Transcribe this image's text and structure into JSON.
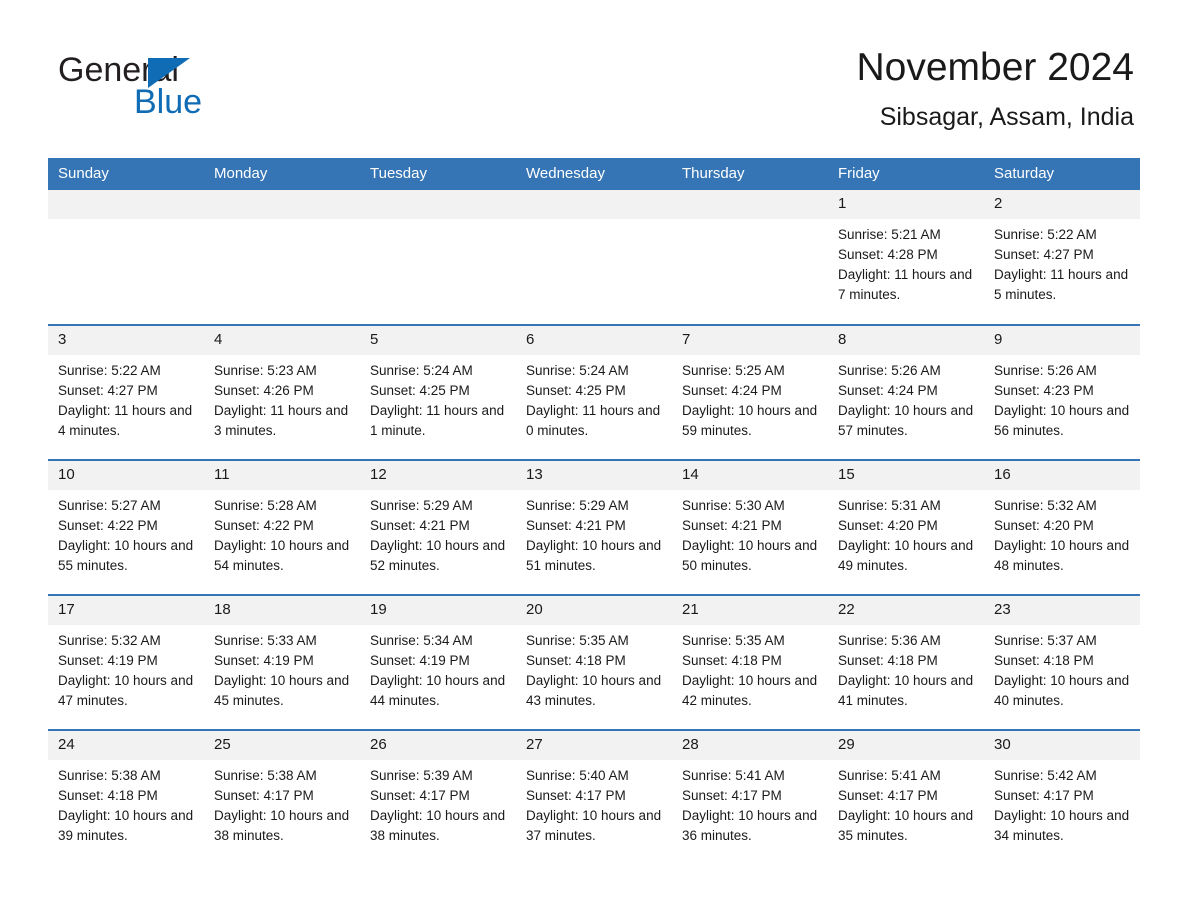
{
  "brand": {
    "name_part1": "General",
    "name_part2": "Blue",
    "accent_color": "#0f6cb5",
    "triangle_icon": "brand-triangle-icon"
  },
  "header": {
    "month_title": "November 2024",
    "location": "Sibsagar, Assam, India"
  },
  "theme": {
    "header_blue": "#3575b5",
    "row_divider_blue": "#3575b5",
    "daynum_band": "#f2f2f2",
    "text": "#1a1a1a"
  },
  "weekday_headers": [
    "Sunday",
    "Monday",
    "Tuesday",
    "Wednesday",
    "Thursday",
    "Friday",
    "Saturday"
  ],
  "labels": {
    "sunrise_prefix": "Sunrise:",
    "sunset_prefix": "Sunset:",
    "daylight_prefix": "Daylight:"
  },
  "weeks": [
    [
      {
        "day": "",
        "empty": true
      },
      {
        "day": "",
        "empty": true
      },
      {
        "day": "",
        "empty": true
      },
      {
        "day": "",
        "empty": true
      },
      {
        "day": "",
        "empty": true
      },
      {
        "day": "1",
        "sunrise": "Sunrise: 5:21 AM",
        "sunset": "Sunset: 4:28 PM",
        "daylight": "Daylight: 11 hours and 7 minutes."
      },
      {
        "day": "2",
        "sunrise": "Sunrise: 5:22 AM",
        "sunset": "Sunset: 4:27 PM",
        "daylight": "Daylight: 11 hours and 5 minutes."
      }
    ],
    [
      {
        "day": "3",
        "sunrise": "Sunrise: 5:22 AM",
        "sunset": "Sunset: 4:27 PM",
        "daylight": "Daylight: 11 hours and 4 minutes."
      },
      {
        "day": "4",
        "sunrise": "Sunrise: 5:23 AM",
        "sunset": "Sunset: 4:26 PM",
        "daylight": "Daylight: 11 hours and 3 minutes."
      },
      {
        "day": "5",
        "sunrise": "Sunrise: 5:24 AM",
        "sunset": "Sunset: 4:25 PM",
        "daylight": "Daylight: 11 hours and 1 minute."
      },
      {
        "day": "6",
        "sunrise": "Sunrise: 5:24 AM",
        "sunset": "Sunset: 4:25 PM",
        "daylight": "Daylight: 11 hours and 0 minutes."
      },
      {
        "day": "7",
        "sunrise": "Sunrise: 5:25 AM",
        "sunset": "Sunset: 4:24 PM",
        "daylight": "Daylight: 10 hours and 59 minutes."
      },
      {
        "day": "8",
        "sunrise": "Sunrise: 5:26 AM",
        "sunset": "Sunset: 4:24 PM",
        "daylight": "Daylight: 10 hours and 57 minutes."
      },
      {
        "day": "9",
        "sunrise": "Sunrise: 5:26 AM",
        "sunset": "Sunset: 4:23 PM",
        "daylight": "Daylight: 10 hours and 56 minutes."
      }
    ],
    [
      {
        "day": "10",
        "sunrise": "Sunrise: 5:27 AM",
        "sunset": "Sunset: 4:22 PM",
        "daylight": "Daylight: 10 hours and 55 minutes."
      },
      {
        "day": "11",
        "sunrise": "Sunrise: 5:28 AM",
        "sunset": "Sunset: 4:22 PM",
        "daylight": "Daylight: 10 hours and 54 minutes."
      },
      {
        "day": "12",
        "sunrise": "Sunrise: 5:29 AM",
        "sunset": "Sunset: 4:21 PM",
        "daylight": "Daylight: 10 hours and 52 minutes."
      },
      {
        "day": "13",
        "sunrise": "Sunrise: 5:29 AM",
        "sunset": "Sunset: 4:21 PM",
        "daylight": "Daylight: 10 hours and 51 minutes."
      },
      {
        "day": "14",
        "sunrise": "Sunrise: 5:30 AM",
        "sunset": "Sunset: 4:21 PM",
        "daylight": "Daylight: 10 hours and 50 minutes."
      },
      {
        "day": "15",
        "sunrise": "Sunrise: 5:31 AM",
        "sunset": "Sunset: 4:20 PM",
        "daylight": "Daylight: 10 hours and 49 minutes."
      },
      {
        "day": "16",
        "sunrise": "Sunrise: 5:32 AM",
        "sunset": "Sunset: 4:20 PM",
        "daylight": "Daylight: 10 hours and 48 minutes."
      }
    ],
    [
      {
        "day": "17",
        "sunrise": "Sunrise: 5:32 AM",
        "sunset": "Sunset: 4:19 PM",
        "daylight": "Daylight: 10 hours and 47 minutes."
      },
      {
        "day": "18",
        "sunrise": "Sunrise: 5:33 AM",
        "sunset": "Sunset: 4:19 PM",
        "daylight": "Daylight: 10 hours and 45 minutes."
      },
      {
        "day": "19",
        "sunrise": "Sunrise: 5:34 AM",
        "sunset": "Sunset: 4:19 PM",
        "daylight": "Daylight: 10 hours and 44 minutes."
      },
      {
        "day": "20",
        "sunrise": "Sunrise: 5:35 AM",
        "sunset": "Sunset: 4:18 PM",
        "daylight": "Daylight: 10 hours and 43 minutes."
      },
      {
        "day": "21",
        "sunrise": "Sunrise: 5:35 AM",
        "sunset": "Sunset: 4:18 PM",
        "daylight": "Daylight: 10 hours and 42 minutes."
      },
      {
        "day": "22",
        "sunrise": "Sunrise: 5:36 AM",
        "sunset": "Sunset: 4:18 PM",
        "daylight": "Daylight: 10 hours and 41 minutes."
      },
      {
        "day": "23",
        "sunrise": "Sunrise: 5:37 AM",
        "sunset": "Sunset: 4:18 PM",
        "daylight": "Daylight: 10 hours and 40 minutes."
      }
    ],
    [
      {
        "day": "24",
        "sunrise": "Sunrise: 5:38 AM",
        "sunset": "Sunset: 4:18 PM",
        "daylight": "Daylight: 10 hours and 39 minutes."
      },
      {
        "day": "25",
        "sunrise": "Sunrise: 5:38 AM",
        "sunset": "Sunset: 4:17 PM",
        "daylight": "Daylight: 10 hours and 38 minutes."
      },
      {
        "day": "26",
        "sunrise": "Sunrise: 5:39 AM",
        "sunset": "Sunset: 4:17 PM",
        "daylight": "Daylight: 10 hours and 38 minutes."
      },
      {
        "day": "27",
        "sunrise": "Sunrise: 5:40 AM",
        "sunset": "Sunset: 4:17 PM",
        "daylight": "Daylight: 10 hours and 37 minutes."
      },
      {
        "day": "28",
        "sunrise": "Sunrise: 5:41 AM",
        "sunset": "Sunset: 4:17 PM",
        "daylight": "Daylight: 10 hours and 36 minutes."
      },
      {
        "day": "29",
        "sunrise": "Sunrise: 5:41 AM",
        "sunset": "Sunset: 4:17 PM",
        "daylight": "Daylight: 10 hours and 35 minutes."
      },
      {
        "day": "30",
        "sunrise": "Sunrise: 5:42 AM",
        "sunset": "Sunset: 4:17 PM",
        "daylight": "Daylight: 10 hours and 34 minutes."
      }
    ]
  ]
}
